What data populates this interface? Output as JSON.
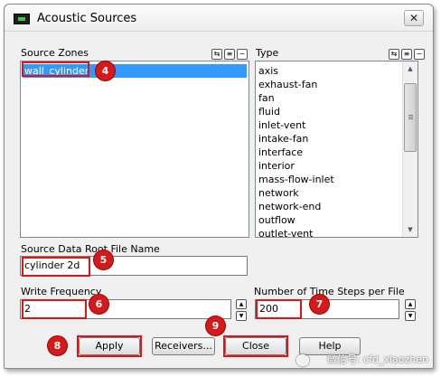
{
  "window": {
    "title": "Acoustic Sources",
    "close_glyph": "✕"
  },
  "source_zones": {
    "label": "Source Zones",
    "items": [
      "wall_cylinder"
    ]
  },
  "type_list": {
    "label": "Type",
    "items": [
      "axis",
      "exhaust-fan",
      "fan",
      "fluid",
      "inlet-vent",
      "intake-fan",
      "interface",
      "interior",
      "mass-flow-inlet",
      "network",
      "network-end",
      "outflow",
      "outlet-vent"
    ]
  },
  "root_file": {
    "label": "Source Data Root File Name",
    "value": "cylinder 2d"
  },
  "write_frequency": {
    "label": "Write Frequency",
    "value": "2"
  },
  "time_steps": {
    "label": "Number of Time Steps per File",
    "value": "200"
  },
  "buttons": {
    "apply": "Apply",
    "receivers": "Receivers...",
    "close": "Close",
    "help": "Help"
  },
  "badges": [
    "4",
    "5",
    "6",
    "7",
    "8",
    "9"
  ],
  "watermark": "微信号: cfd_xiaozhen",
  "colors": {
    "annotation_red": "#e01414",
    "badge_red": "#d41a1a",
    "selection_blue": "#3399ff"
  }
}
